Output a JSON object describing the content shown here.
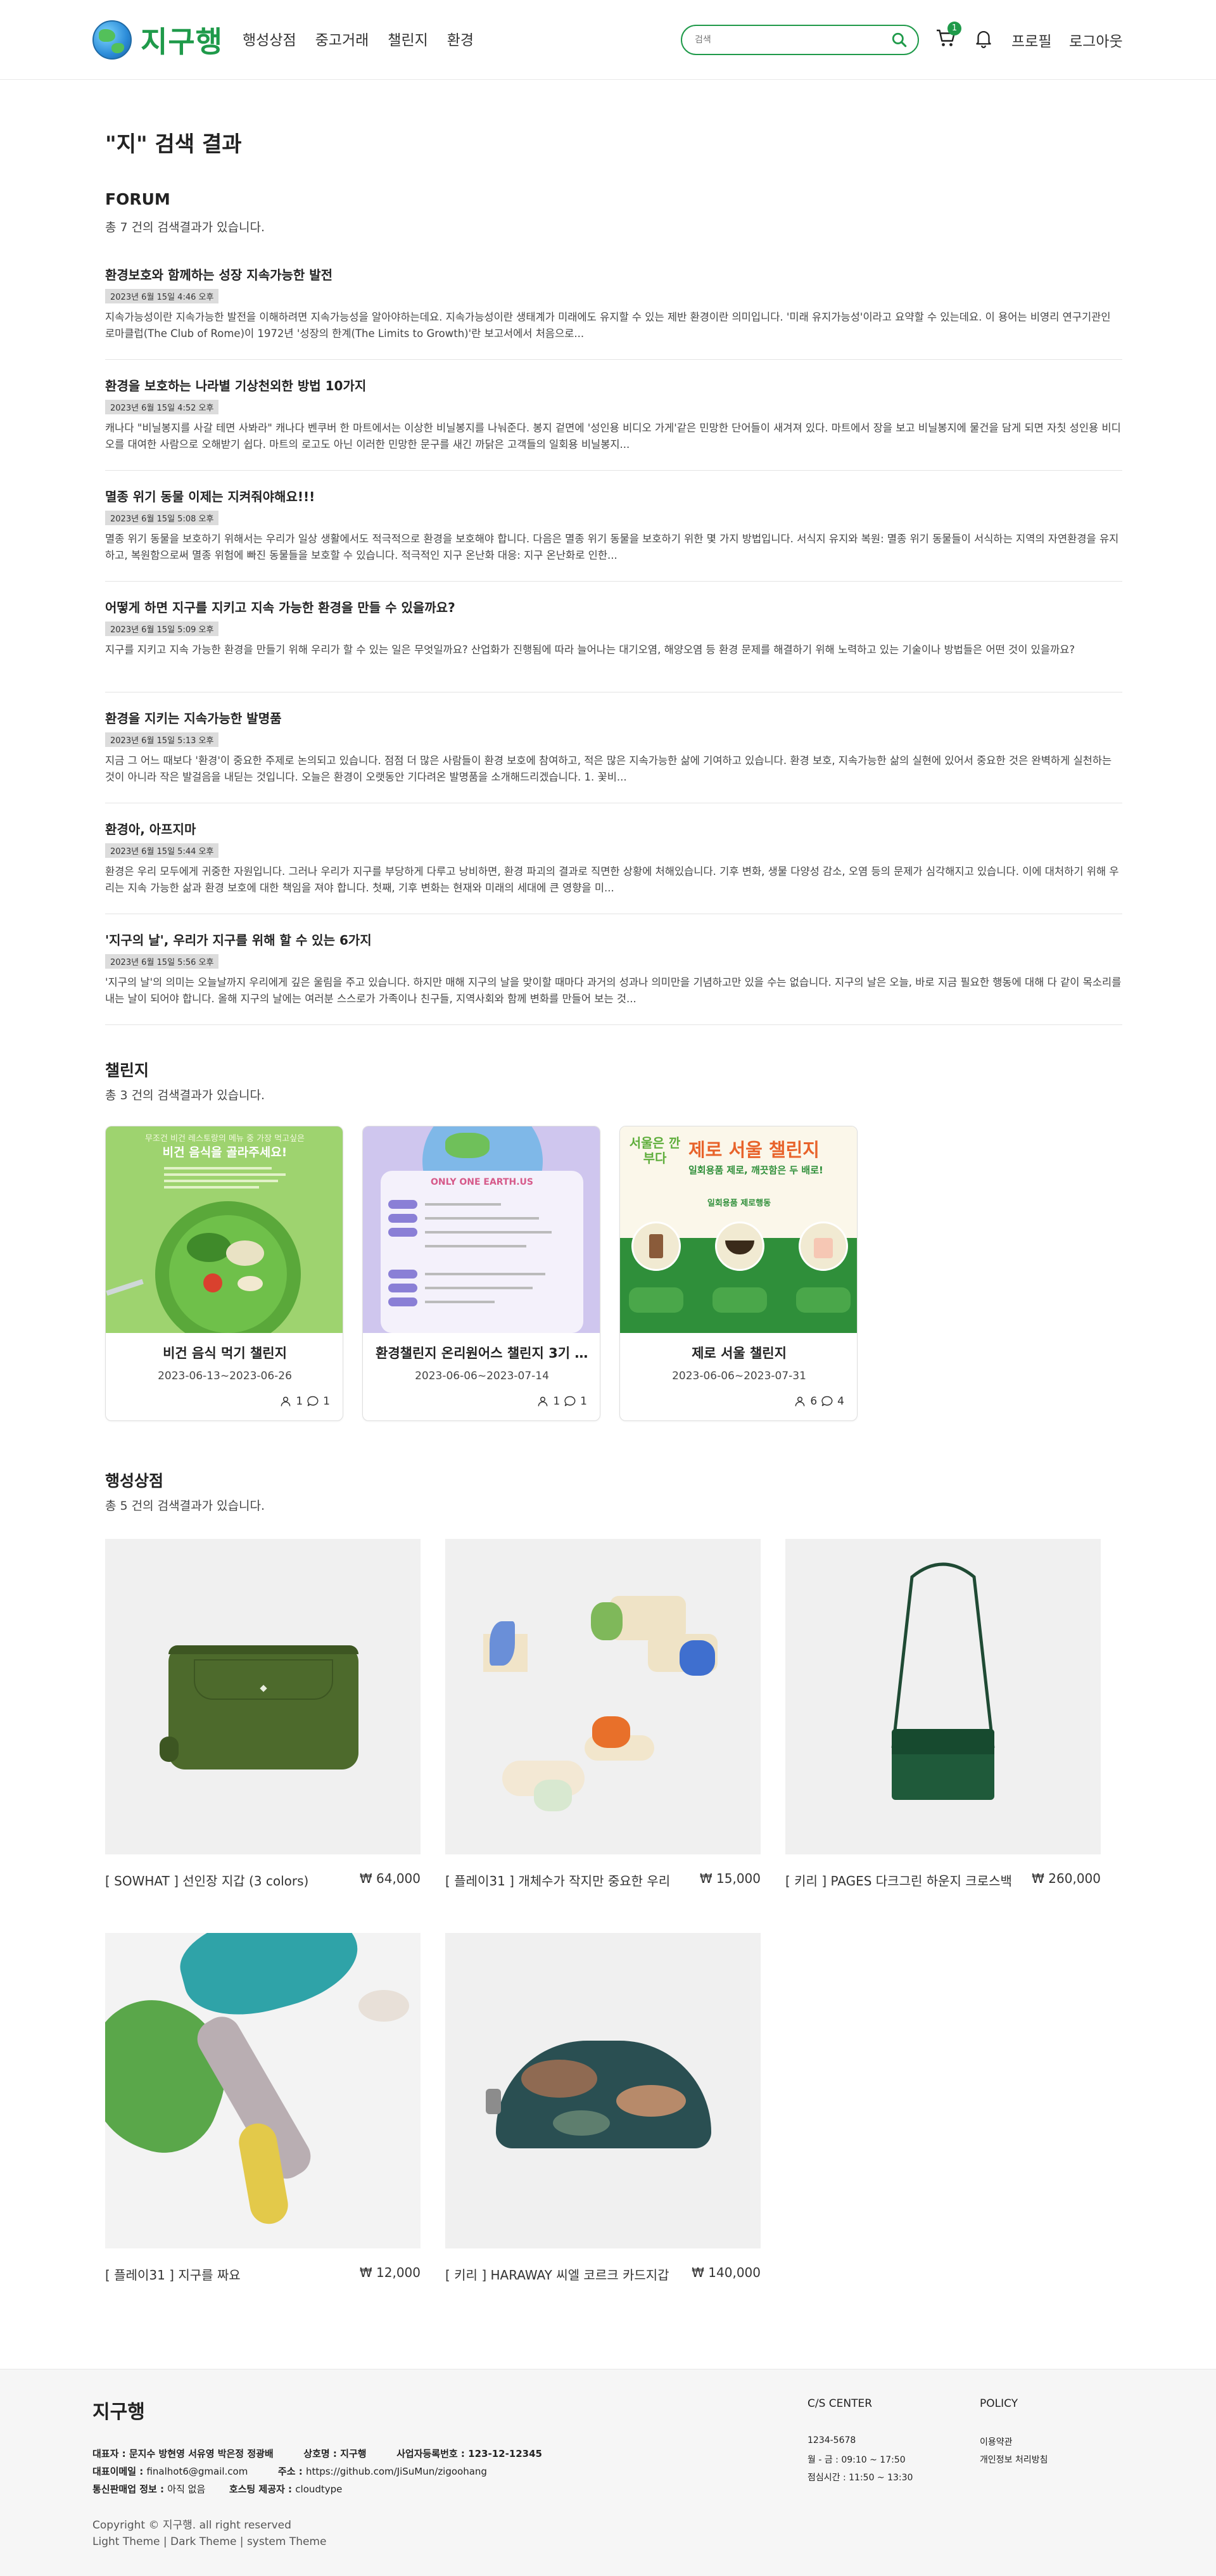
{
  "header": {
    "logo_text": "지구행",
    "nav": [
      "행성상점",
      "중고거래",
      "챌린지",
      "환경"
    ],
    "search_placeholder": "검색",
    "cart_count": "1",
    "profile": "프로필",
    "logout": "로그아웃"
  },
  "page_title": "\"지\" 검색 결과",
  "forum": {
    "title": "FORUM",
    "count_text": "총 7 건의 검색결과가 있습니다.",
    "posts": [
      {
        "title": "환경보호와 함께하는 성장 지속가능한 발전",
        "date": "2023년 6월 15일 4:46 오후",
        "body": "지속가능성이란 지속가능한 발전을 이해하려면 지속가능성을 알아야하는데요. 지속가능성이란 생태계가 미래에도 유지할 수 있는 제반 환경이란 의미입니다. '미래 유지가능성'이라고 요약할 수 있는데요. 이 용어는 비영리 연구기관인 로마클럽(The Club of Rome)이 1972년 '성장의 한계(The Limits to Growth)'란 보고서에서 처음으로..."
      },
      {
        "title": "환경을 보호하는 나라별 기상천외한 방법 10가지",
        "date": "2023년 6월 15일 4:52 오후",
        "body": "캐나다 \"비닐봉지를 사갈 테면 사봐라\" 캐나다 벤쿠버 한 마트에서는 이상한 비닐봉지를 나눠준다. 봉지 겉면에 '성인용 비디오 가게'같은 민망한 단어들이 새겨져 있다. 마트에서 장을 보고 비닐봉지에 물건을 담게 되면 자칫 성인용 비디오를 대여한 사람으로 오해받기 쉽다. 마트의 로고도 아닌 이러한 민망한 문구를 새긴 까닭은 고객들의 일회용 비닐봉지..."
      },
      {
        "title": "멸종 위기 동물 이제는 지켜줘야해요!!!",
        "date": "2023년 6월 15일 5:08 오후",
        "body": "멸종 위기 동물을 보호하기 위해서는 우리가 일상 생활에서도 적극적으로 환경을 보호해야 합니다. 다음은 멸종 위기 동물을 보호하기 위한 몇 가지 방법입니다. 서식지 유지와 복원: 멸종 위기 동물들이 서식하는 지역의 자연환경을 유지하고, 복원함으로써 멸종 위험에 빠진 동물들을 보호할 수 있습니다. 적극적인 지구 온난화 대응: 지구 온난화로 인한..."
      },
      {
        "title": "어떻게 하면 지구를 지키고 지속 가능한 환경을 만들 수 있을까요?",
        "date": "2023년 6월 15일 5:09 오후",
        "body": "지구를 지키고 지속 가능한 환경을 만들기 위해 우리가 할 수 있는 일은 무엇일까요? 산업화가 진행됨에 따라 늘어나는 대기오염, 해양오염 등 환경 문제를 해결하기 위해 노력하고 있는 기술이나 방법들은 어떤 것이 있을까요?"
      },
      {
        "title": "환경을 지키는 지속가능한 발명품",
        "date": "2023년 6월 15일 5:13 오후",
        "body": "지금 그 어느 때보다 '환경'이 중요한 주제로 논의되고 있습니다. 점점 더 많은 사람들이 환경 보호에 참여하고, 적은 많은 지속가능한 삶에 기여하고 있습니다. 환경 보호, 지속가능한 삶의 실현에 있어서 중요한 것은 완벽하게 실천하는 것이 아니라 작은 발걸음을 내딛는 것입니다. 오늘은 환경이 오랫동안 기다려온 발명품을 소개해드리겠습니다. 1. 꽃비..."
      },
      {
        "title": "환경아, 아프지마",
        "date": "2023년 6월 15일 5:44 오후",
        "body": "환경은 우리 모두에게 귀중한 자원입니다. 그러나 우리가 지구를 부당하게 다루고 낭비하면, 환경 파괴의 결과로 직면한 상황에 처해있습니다. 기후 변화, 생물 다양성 감소, 오염 등의 문제가 심각해지고 있습니다. 이에 대처하기 위해 우리는 지속 가능한 삶과 환경 보호에 대한 책임을 져야 합니다. 첫째, 기후 변화는 현재와 미래의 세대에 큰 영향을 미..."
      },
      {
        "title": "'지구의 날', 우리가 지구를 위해 할 수 있는 6가지",
        "date": "2023년 6월 15일 5:56 오후",
        "body": "'지구의 날'의 의미는 오늘날까지 우리에게 깊은 울림을 주고 있습니다. 하지만 매해 지구의 날을 맞이할 때마다 과거의 성과나 의미만을 기념하고만 있을 수는 없습니다. 지구의 날은 오늘, 바로 지금 필요한 행동에 대해 다 같이 목소리를 내는 날이 되어야 합니다. 올해 지구의 날에는 여러분 스스로가 가족이나 친구들, 지역사회와 함께 변화를 만들어 보는 것..."
      }
    ]
  },
  "challenge": {
    "title": "챌린지",
    "count_text": "총 3 건의 검색결과가 있습니다.",
    "cards": [
      {
        "title": "비건 음식 먹기 챌린지",
        "date": "2023-06-13~2023-06-26",
        "participants": "1",
        "comments": "1",
        "img_text_1": "무조건 비건 레스토랑의 메뉴 중 가장 먹고싶은",
        "img_text_2": "비건 음식을 골라주세요!"
      },
      {
        "title": "환경챌린지 온리원어스 챌린지 3기 ...",
        "date": "2023-06-06~2023-07-14",
        "participants": "1",
        "comments": "1",
        "img_text_1": "ONLY ONE EARTH.US"
      },
      {
        "title": "제로 서울 챌린지",
        "date": "2023-06-06~2023-07-31",
        "participants": "6",
        "comments": "4",
        "img_text_1": "제로 서울 챌린지",
        "img_text_2": "일회용품 제로, 깨끗함은 두 배로!",
        "img_text_3": "일회용품 제로행동",
        "img_side": "서울은 깐부다"
      }
    ]
  },
  "shop": {
    "title": "행성상점",
    "count_text": "총 5 건의 검색결과가 있습니다.",
    "products": [
      {
        "name": "[ SOWHAT ] 선인장 지갑 (3 colors)",
        "price": "₩ 64,000"
      },
      {
        "name": "[ 플레이31 ] 개체수가 작지만 중요한 우리",
        "price": "₩ 15,000"
      },
      {
        "name": "[ 키리 ] PAGES 다크그린 하운지 크로스백",
        "price": "₩ 260,000"
      },
      {
        "name": "[ 플레이31 ] 지구를 짜요",
        "price": "₩ 12,000"
      },
      {
        "name": "[ 키리 ] HARAWAY 씨엘 코르크 카드지갑",
        "price": "₩ 140,000"
      }
    ]
  },
  "footer": {
    "logo": "지구행",
    "ceo_label": "대표자 : ",
    "ceo_value": "문지수 방현영 서유영 박은정 정광배",
    "trade_label": "상호명 : ",
    "trade_value": "지구행",
    "biz_label": "사업자등록번호 : ",
    "biz_value": "123-12-12345",
    "email_label": "대표이메일 : ",
    "email_value": "finalhot6@gmail.com",
    "addr_label": "주소 : ",
    "addr_value": "https://github.com/JiSuMun/zigoohang",
    "telecom_label": "통신판매업 정보 : ",
    "telecom_value": "아직 없음",
    "hosting_label": "호스팅 제공자 : ",
    "hosting_value": "cloudtype",
    "copyright": "Copyright © 지구행. all right reserved",
    "theme_light": "Light Theme",
    "theme_dark": "Dark Theme",
    "theme_system": "system Theme",
    "cs_title": "C/S CENTER",
    "cs_phone": "1234-5678",
    "cs_hours": "월 - 금 : 09:10 ~ 17:50",
    "cs_lunch": "점심시간 : 11:50 ~ 13:30",
    "policy_title": "POLICY",
    "policy_terms": "이용약관",
    "policy_privacy": "개인정보 처리방침"
  },
  "colors": {
    "brand": "#1f9a4a",
    "date_bg": "#dcdcdc",
    "footer_bg": "#f6f6f6"
  },
  "icons": [
    "search-icon",
    "cart-icon",
    "bell-icon",
    "user-icon",
    "comment-icon"
  ]
}
